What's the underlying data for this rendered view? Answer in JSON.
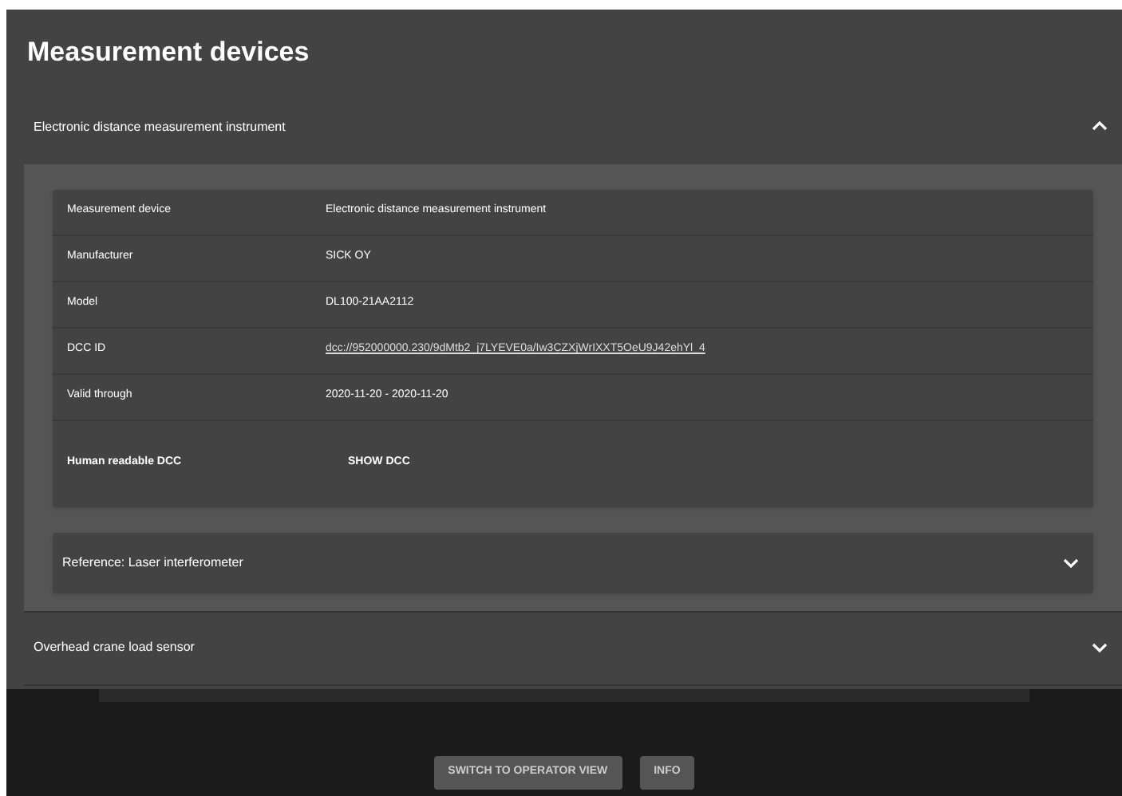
{
  "title": "Measurement devices",
  "devices": [
    {
      "name": "Electronic distance measurement instrument",
      "expanded": true,
      "details": [
        {
          "kind": "text",
          "label": "Measurement device",
          "value": "Electronic distance measurement instrument"
        },
        {
          "kind": "text",
          "label": "Manufacturer",
          "value": "SICK OY"
        },
        {
          "kind": "text",
          "label": "Model",
          "value": "DL100-21AA2112"
        },
        {
          "kind": "link",
          "label": "DCC ID",
          "value": "dcc://952000000.230/9dMtb2_j7LYEVE0a/Iw3CZXjWrIXXT5OeU9J42ehYl_4"
        },
        {
          "kind": "text",
          "label": "Valid through",
          "value": "2020-11-20 - 2020-11-20"
        },
        {
          "kind": "button",
          "label": "Human readable DCC",
          "value": "SHOW DCC"
        }
      ],
      "references": [
        {
          "name": "Reference: Laser interferometer",
          "expanded": false
        }
      ]
    },
    {
      "name": "Overhead crane load sensor",
      "expanded": false
    }
  ],
  "footer_buttons": [
    "SWITCH TO OPERATOR VIEW",
    "INFO"
  ]
}
